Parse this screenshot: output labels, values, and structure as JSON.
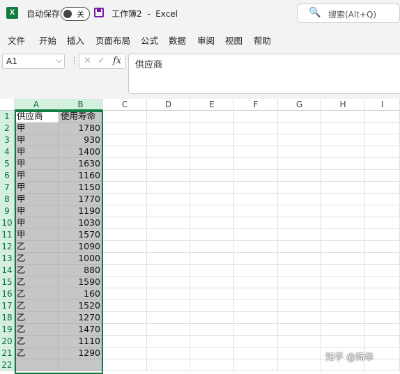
{
  "titlebar": {
    "app_icon": "X",
    "autosave_label": "自动保存",
    "autosave_state": "关",
    "document_title": "工作簿2  -  Excel",
    "search_icon": "🔍",
    "search_placeholder": "搜索(Alt+Q)"
  },
  "menu": [
    "文件",
    "开始",
    "插入",
    "页面布局",
    "公式",
    "数据",
    "审阅",
    "视图",
    "帮助"
  ],
  "formula_bar": {
    "name_box": "A1",
    "name_box_dropdown": "⌵",
    "more_dots": "⋮",
    "cancel": "✕",
    "enter": "✓",
    "fx": "fx",
    "content": "供应商"
  },
  "sheet": {
    "columns": [
      "A",
      "B",
      "C",
      "D",
      "E",
      "F",
      "G",
      "H",
      "I"
    ],
    "row_numbers": [
      "1",
      "2",
      "3",
      "4",
      "5",
      "6",
      "7",
      "8",
      "9",
      "10",
      "11",
      "12",
      "13",
      "14",
      "15",
      "16",
      "17",
      "18",
      "19",
      "20",
      "21",
      "22"
    ],
    "rows": [
      [
        "供应商",
        "使用寿命"
      ],
      [
        "甲",
        "1780"
      ],
      [
        "甲",
        "930"
      ],
      [
        "甲",
        "1400"
      ],
      [
        "甲",
        "1630"
      ],
      [
        "甲",
        "1160"
      ],
      [
        "甲",
        "1150"
      ],
      [
        "甲",
        "1770"
      ],
      [
        "甲",
        "1190"
      ],
      [
        "甲",
        "1030"
      ],
      [
        "甲",
        "1570"
      ],
      [
        "乙",
        "1090"
      ],
      [
        "乙",
        "1000"
      ],
      [
        "乙",
        "880"
      ],
      [
        "乙",
        "1590"
      ],
      [
        "乙",
        "160"
      ],
      [
        "乙",
        "1520"
      ],
      [
        "乙",
        "1270"
      ],
      [
        "乙",
        "1470"
      ],
      [
        "乙",
        "1110"
      ],
      [
        "乙",
        "1290"
      ],
      [
        "",
        ""
      ]
    ]
  },
  "watermark": "知乎 @简单"
}
